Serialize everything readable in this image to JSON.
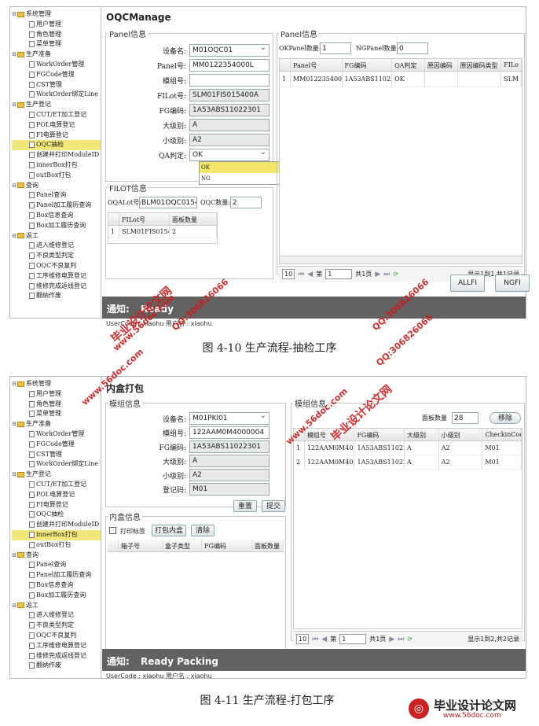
{
  "tree": [
    {
      "label": "系统管理",
      "level": 0
    },
    {
      "label": "用户管理",
      "level": 1
    },
    {
      "label": "角色管理",
      "level": 1
    },
    {
      "label": "菜单管理",
      "level": 1
    },
    {
      "label": "生产准备",
      "level": 0
    },
    {
      "label": "WorkOrder管理",
      "level": 1
    },
    {
      "label": "FGCode管理",
      "level": 1
    },
    {
      "label": "CST管理",
      "level": 1
    },
    {
      "label": "WorkOrder绑定Line",
      "level": 1
    },
    {
      "label": "生产登记",
      "level": 0
    },
    {
      "label": "CUT/ET加工登记",
      "level": 1
    },
    {
      "label": "POL电算登记",
      "level": 1
    },
    {
      "label": "FI电算登记",
      "level": 1
    },
    {
      "label": "OQC抽检",
      "level": 1
    },
    {
      "label": "创建并打印ModuleID",
      "level": 1
    },
    {
      "label": "innerBox打包",
      "level": 1
    },
    {
      "label": "outBox打包",
      "level": 1
    },
    {
      "label": "查询",
      "level": 0
    },
    {
      "label": "Panel查询",
      "level": 1
    },
    {
      "label": "Panel加工履历查询",
      "level": 1
    },
    {
      "label": "Box信息查询",
      "level": 1
    },
    {
      "label": "Box加工履历查询",
      "level": 1
    },
    {
      "label": "返工",
      "level": 0
    },
    {
      "label": "进入维修登记",
      "level": 1
    },
    {
      "label": "不良类型判定",
      "level": 1
    },
    {
      "label": "OQC不良复判",
      "level": 1
    },
    {
      "label": "工序维修电算登记",
      "level": 1
    },
    {
      "label": "维修完成返线登记",
      "level": 1
    },
    {
      "label": "翻纳作废",
      "level": 1
    }
  ],
  "s1": {
    "title": "OQCManage",
    "panel_info_legend": "Panel信息",
    "fields": [
      {
        "label": "设备名:",
        "value": "M01OQC01",
        "ro": false,
        "select": true
      },
      {
        "label": "Panel号:",
        "value": "MM0122354000L",
        "ro": false,
        "select": false
      },
      {
        "label": "模组号:",
        "value": "",
        "ro": false,
        "select": false
      },
      {
        "label": "FILot号:",
        "value": "SLM01FIS015400A",
        "ro": true,
        "select": false
      },
      {
        "label": "FG编码:",
        "value": "1A53ABS11022301",
        "ro": true,
        "select": false
      },
      {
        "label": "大级别:",
        "value": "A",
        "ro": true,
        "select": false
      },
      {
        "label": "小级别:",
        "value": "A2",
        "ro": true,
        "select": false
      },
      {
        "label": "QA判定:",
        "value": "OK",
        "ro": false,
        "select": true
      }
    ],
    "qa_options": [
      "OK",
      "NG"
    ],
    "filot_legend": "FILOT信息",
    "oqalot_label": "OQALot号:",
    "oqalot_value": "BLM01OQC01540",
    "oqc_count_label": "OQC数量:",
    "oqc_count_value": "2",
    "filot_cols": [
      "FILot号",
      "面板数量"
    ],
    "filot_rows": [
      [
        "1",
        "SLM01FIS015400A",
        "2"
      ]
    ],
    "panel_right_legend": "Panel信息",
    "ok_label": "OKPanel数量:",
    "ok_value": "1",
    "ng_label": "NGPanel数量:",
    "ng_value": "0",
    "panel_cols": [
      "Panel号",
      "FG编码",
      "QA判定",
      "原因编码",
      "原因编码类型",
      "FILo"
    ],
    "panel_rows": [
      [
        "1",
        "MM0122354000L",
        "1A53ABS11022301",
        "OK",
        "",
        "",
        "SLM"
      ]
    ],
    "pager": {
      "size": "10",
      "page_label": "第",
      "page": "1",
      "total": "共1页",
      "info": "显示1到1,共1记录"
    },
    "allfi": "ALLFI",
    "ngfi": "NGFI",
    "notice_label": "通知:",
    "notice_text": "Ready",
    "user_line": "UserCode : xiaohu  用户名 : xiaohu",
    "caption": "图 4-10  生产流程-抽检工序"
  },
  "s2": {
    "title": "内盒打包",
    "module_legend": "模组信息",
    "fields": [
      {
        "label": "设备名:",
        "value": "M01PKI01",
        "ro": false,
        "select": true
      },
      {
        "label": "模组号:",
        "value": "122AAM0M4000004",
        "ro": false,
        "select": false
      },
      {
        "label": "FG编码:",
        "value": "1A53ABS11022301",
        "ro": true,
        "select": false
      },
      {
        "label": "大级别:",
        "value": "A",
        "ro": true,
        "select": false
      },
      {
        "label": "小级别:",
        "value": "A2",
        "ro": true,
        "select": false
      },
      {
        "label": "登记码:",
        "value": "M01",
        "ro": true,
        "select": false
      }
    ],
    "reset": "重置",
    "submit": "提交",
    "box_legend": "内盒信息",
    "print_label": "打印标签",
    "pack_btn": "打包内盒",
    "clear_btn": "清除",
    "box_cols": [
      "箱子号",
      "盒子类型",
      "FG编码",
      "面板数量"
    ],
    "module_right_legend": "模组信息",
    "count_label": "面板数量",
    "count_value": "28",
    "remove_btn": "移除",
    "module_cols": [
      "模组号",
      "FG编码",
      "大级别",
      "小级别",
      "CheckinCod"
    ],
    "module_rows": [
      [
        "1",
        "122AAM0M4000003",
        "1A53ABS11022301",
        "A",
        "A2",
        "M01"
      ],
      [
        "2",
        "122AAM0M4000004",
        "1A53ABS11022301",
        "A",
        "A2",
        "M01"
      ]
    ],
    "pager": {
      "size": "10",
      "page_label": "第",
      "page": "1",
      "total": "共1页",
      "info": "显示1到2,共2记录"
    },
    "notice_label": "通知:",
    "notice_text": "Ready Packing",
    "user_line": "UserCode : xiaohu  用户名 : xiaohu",
    "caption": "图 4-11  生产流程-打包工序"
  },
  "watermarks": [
    "毕业设计论文网",
    "www.56doc.com",
    "QQ:306826066"
  ],
  "logo": {
    "title": "毕业设计论文网",
    "url": "www.56doc.com"
  }
}
